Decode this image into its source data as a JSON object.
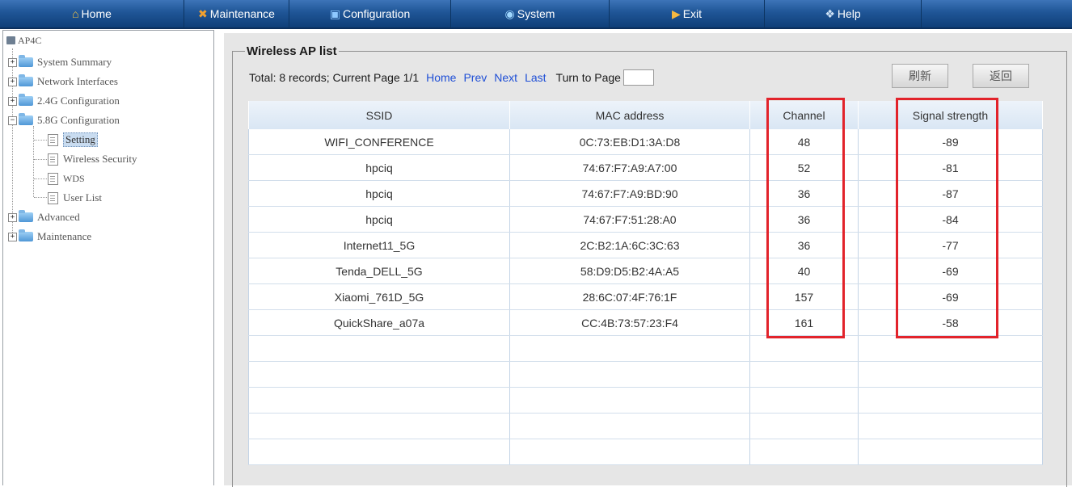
{
  "nav": {
    "items": [
      {
        "label": "Home",
        "icon": "home-icon"
      },
      {
        "label": "Maintenance",
        "icon": "tools-icon"
      },
      {
        "label": "Configuration",
        "icon": "monitor-icon"
      },
      {
        "label": "System",
        "icon": "globe-icon"
      },
      {
        "label": "Exit",
        "icon": "exit-icon"
      },
      {
        "label": "Help",
        "icon": "help-icon"
      }
    ]
  },
  "sidebar": {
    "root": "AP4C",
    "items": [
      {
        "label": "System Summary"
      },
      {
        "label": "Network Interfaces"
      },
      {
        "label": "2.4G Configuration"
      },
      {
        "label": "5.8G Configuration"
      },
      {
        "label": "Setting"
      },
      {
        "label": "Wireless Security"
      },
      {
        "label": "WDS"
      },
      {
        "label": "User List"
      },
      {
        "label": "Advanced"
      },
      {
        "label": "Maintenance"
      }
    ]
  },
  "panel": {
    "title": "Wireless AP list",
    "pager": {
      "summary": "Total: 8 records; Current Page 1/1",
      "home": "Home",
      "prev": "Prev",
      "next": "Next",
      "last": "Last",
      "turn_to": "Turn to Page",
      "page_value": ""
    },
    "refresh_label": "刷新",
    "back_label": "返回"
  },
  "table": {
    "headers": [
      "SSID",
      "MAC address",
      "Channel",
      "Signal strength"
    ],
    "rows": [
      [
        "WIFI_CONFERENCE",
        "0C:73:EB:D1:3A:D8",
        "48",
        "-89"
      ],
      [
        "hpciq",
        "74:67:F7:A9:A7:00",
        "52",
        "-81"
      ],
      [
        "hpciq",
        "74:67:F7:A9:BD:90",
        "36",
        "-87"
      ],
      [
        "hpciq",
        "74:67:F7:51:28:A0",
        "36",
        "-84"
      ],
      [
        "Internet11_5G",
        "2C:B2:1A:6C:3C:63",
        "36",
        "-77"
      ],
      [
        "Tenda_DELL_5G",
        "58:D9:D5:B2:4A:A5",
        "40",
        "-69"
      ],
      [
        "Xiaomi_761D_5G",
        "28:6C:07:4F:76:1F",
        "157",
        "-69"
      ],
      [
        "QuickShare_a07a",
        "CC:4B:73:57:23:F4",
        "161",
        "-58"
      ]
    ]
  },
  "colors": {
    "nav_bar": "#1f5596",
    "link": "#1f4fd6",
    "highlight": "#e2232b",
    "table_header": "#d9e6f4",
    "panel_bg": "#e6e6e6"
  }
}
